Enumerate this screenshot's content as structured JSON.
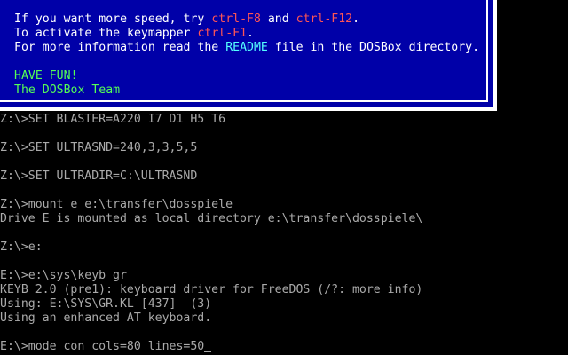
{
  "banner": {
    "line1_a": "If you want more speed, try ",
    "line1_key1": "ctrl-F8",
    "line1_b": " and ",
    "line1_key2": "ctrl-F12",
    "line1_c": ".",
    "line2_a": "To activate the keymapper ",
    "line2_key": "ctrl-F1",
    "line2_b": ".",
    "line3_a": "For more information read the ",
    "line3_readme": "README",
    "line3_b": " file in the DOSBox directory.",
    "have_fun": "HAVE FUN!",
    "team": "The DOSBox Team"
  },
  "terminal": {
    "lines": [
      "Z:\\>SET BLASTER=A220 I7 D1 H5 T6",
      "",
      "Z:\\>SET ULTRASND=240,3,3,5,5",
      "",
      "Z:\\>SET ULTRADIR=C:\\ULTRASND",
      "",
      "Z:\\>mount e e:\\transfer\\dosspiele",
      "Drive E is mounted as local directory e:\\transfer\\dosspiele\\",
      "",
      "Z:\\>e:",
      "",
      "E:\\>e:\\sys\\keyb gr",
      "KEYB 2.0 (pre1): keyboard driver for FreeDOS (/?: more info)",
      "Using: E:\\SYS\\GR.KL [437]  (3)",
      "Using an enhanced AT keyboard.",
      ""
    ],
    "prompt": "E:\\>mode con cols=80 lines=50"
  }
}
